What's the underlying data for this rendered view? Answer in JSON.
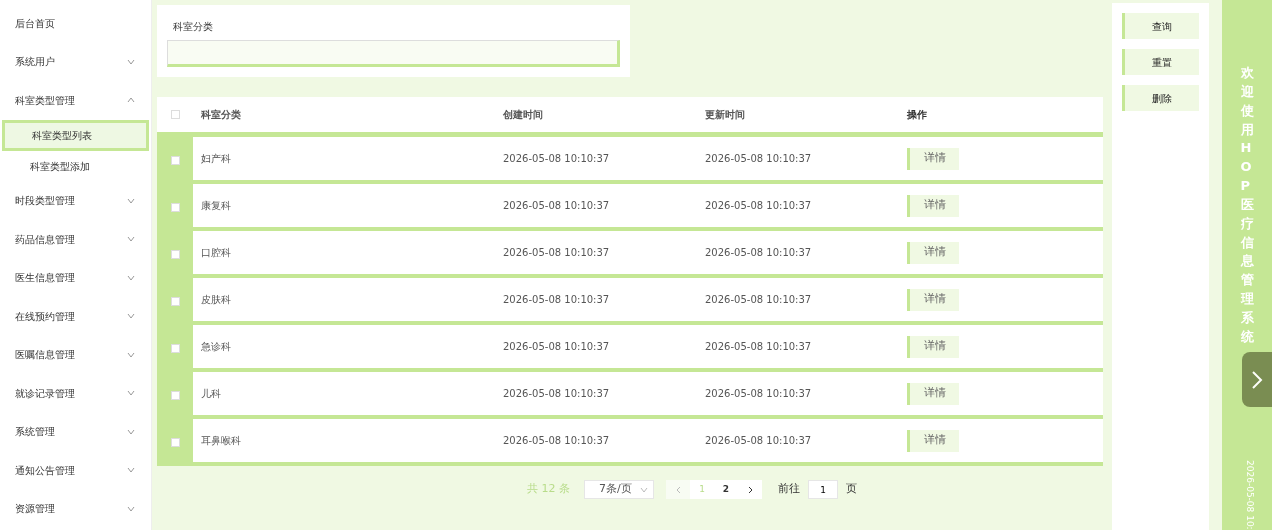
{
  "sidebar": {
    "items": [
      {
        "kind": "link",
        "label": "后台首页"
      },
      {
        "kind": "group",
        "label": "系统用户",
        "expanded": false
      },
      {
        "kind": "group",
        "label": "科室类型管理",
        "expanded": true,
        "children": [
          {
            "label": "科室类型列表",
            "selected": true
          },
          {
            "label": "科室类型添加",
            "selected": false
          }
        ]
      },
      {
        "kind": "group",
        "label": "时段类型管理",
        "expanded": false
      },
      {
        "kind": "group",
        "label": "药品信息管理",
        "expanded": false
      },
      {
        "kind": "group",
        "label": "医生信息管理",
        "expanded": false
      },
      {
        "kind": "group",
        "label": "在线预约管理",
        "expanded": false
      },
      {
        "kind": "group",
        "label": "医嘱信息管理",
        "expanded": false
      },
      {
        "kind": "group",
        "label": "就诊记录管理",
        "expanded": false
      },
      {
        "kind": "group",
        "label": "系统管理",
        "expanded": false
      },
      {
        "kind": "group",
        "label": "通知公告管理",
        "expanded": false
      },
      {
        "kind": "group",
        "label": "资源管理",
        "expanded": false
      }
    ]
  },
  "search": {
    "label": "科室分类"
  },
  "table": {
    "all_checked": false,
    "columns": [
      "科室分类",
      "创建时间",
      "更新时间",
      "操作"
    ],
    "rows": [
      {
        "checked": false,
        "cells": [
          "妇产科",
          "2026-05-08 10:10:37",
          "2026-05-08 10:10:37"
        ],
        "action": "详情"
      },
      {
        "checked": false,
        "cells": [
          "康复科",
          "2026-05-08 10:10:37",
          "2026-05-08 10:10:37"
        ],
        "action": "详情"
      },
      {
        "checked": false,
        "cells": [
          "口腔科",
          "2026-05-08 10:10:37",
          "2026-05-08 10:10:37"
        ],
        "action": "详情"
      },
      {
        "checked": false,
        "cells": [
          "皮肤科",
          "2026-05-08 10:10:37",
          "2026-05-08 10:10:37"
        ],
        "action": "详情"
      },
      {
        "checked": false,
        "cells": [
          "急诊科",
          "2026-05-08 10:10:37",
          "2026-05-08 10:10:37"
        ],
        "action": "详情"
      },
      {
        "checked": false,
        "cells": [
          "儿科",
          "2026-05-08 10:10:37",
          "2026-05-08 10:10:37"
        ],
        "action": "详情"
      },
      {
        "checked": false,
        "cells": [
          "耳鼻喉科",
          "2026-05-08 10:10:37",
          "2026-05-08 10:10:37"
        ],
        "action": "详情"
      }
    ]
  },
  "pagination": {
    "total": "共 12 条",
    "page_size": "7条/页",
    "pages": [
      {
        "label": "1",
        "selected": true
      },
      {
        "label": "2",
        "selected": false
      }
    ],
    "goto_label": "前往",
    "goto_value": "1",
    "goto_suffix": "页"
  },
  "actions": [
    "查询",
    "重置",
    "删除"
  ],
  "banner": {
    "title": "欢迎使用HOP医疗信息管理系统",
    "date": "2026-05-08 10:"
  }
}
